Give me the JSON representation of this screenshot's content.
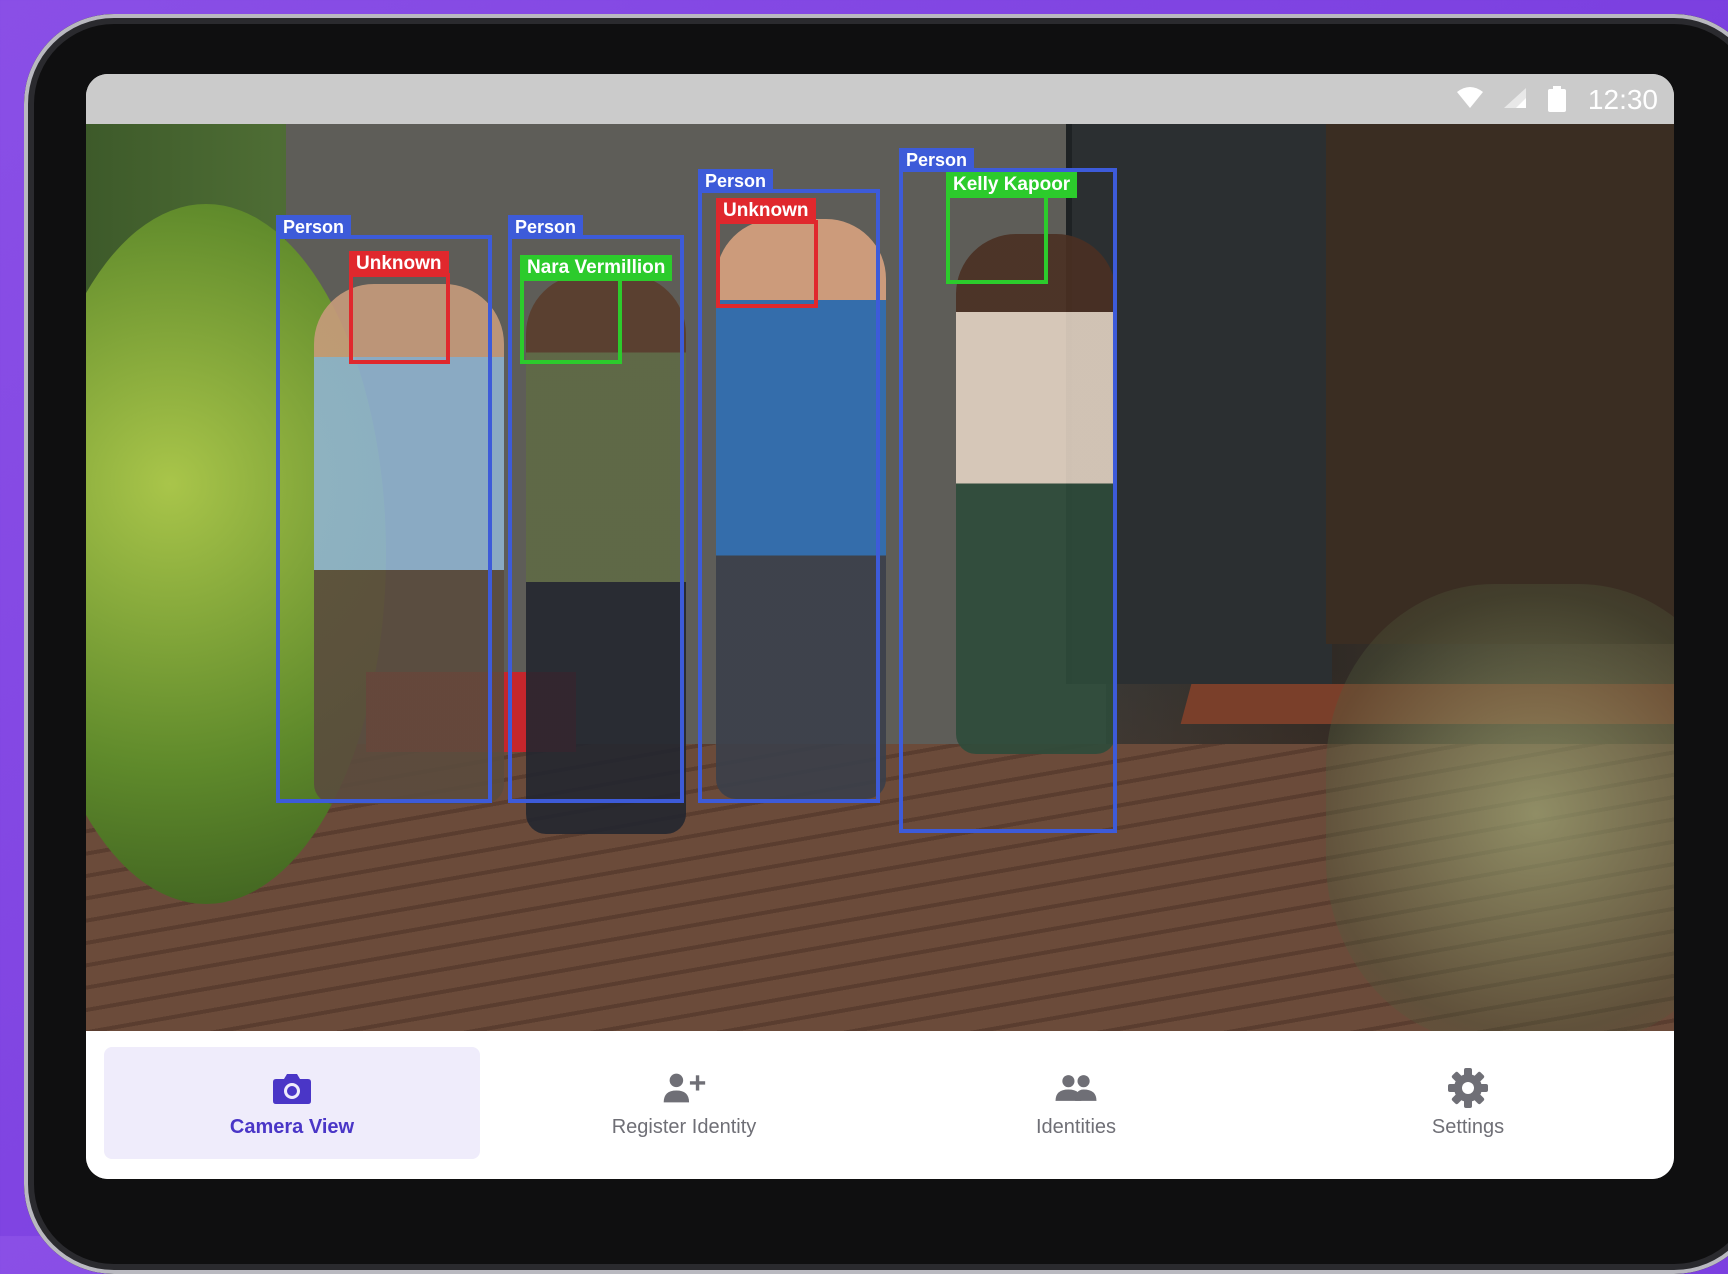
{
  "status_bar": {
    "time": "12:30",
    "icons": [
      "wifi-icon",
      "signal-icon",
      "battery-icon"
    ]
  },
  "camera_view": {
    "detections": [
      {
        "object_label": "Person",
        "face_label": "Unknown",
        "face_status": "unknown"
      },
      {
        "object_label": "Person",
        "face_label": "Nara Vermillion",
        "face_status": "known"
      },
      {
        "object_label": "Person",
        "face_label": "Unknown",
        "face_status": "unknown"
      },
      {
        "object_label": "Person",
        "face_label": "Kelly Kapoor",
        "face_status": "known"
      }
    ],
    "colors": {
      "person_box": "#3d5bd9",
      "unknown_face": "#e0282d",
      "known_face": "#2ccb2c"
    }
  },
  "nav": {
    "items": [
      {
        "label": "Camera View",
        "icon": "camera-icon",
        "active": true
      },
      {
        "label": "Register Identity",
        "icon": "add-person-icon",
        "active": false
      },
      {
        "label": "Identities",
        "icon": "people-icon",
        "active": false
      },
      {
        "label": "Settings",
        "icon": "gear-icon",
        "active": false
      }
    ],
    "active_color": "#4a36c7",
    "inactive_color": "#6f6f76"
  }
}
